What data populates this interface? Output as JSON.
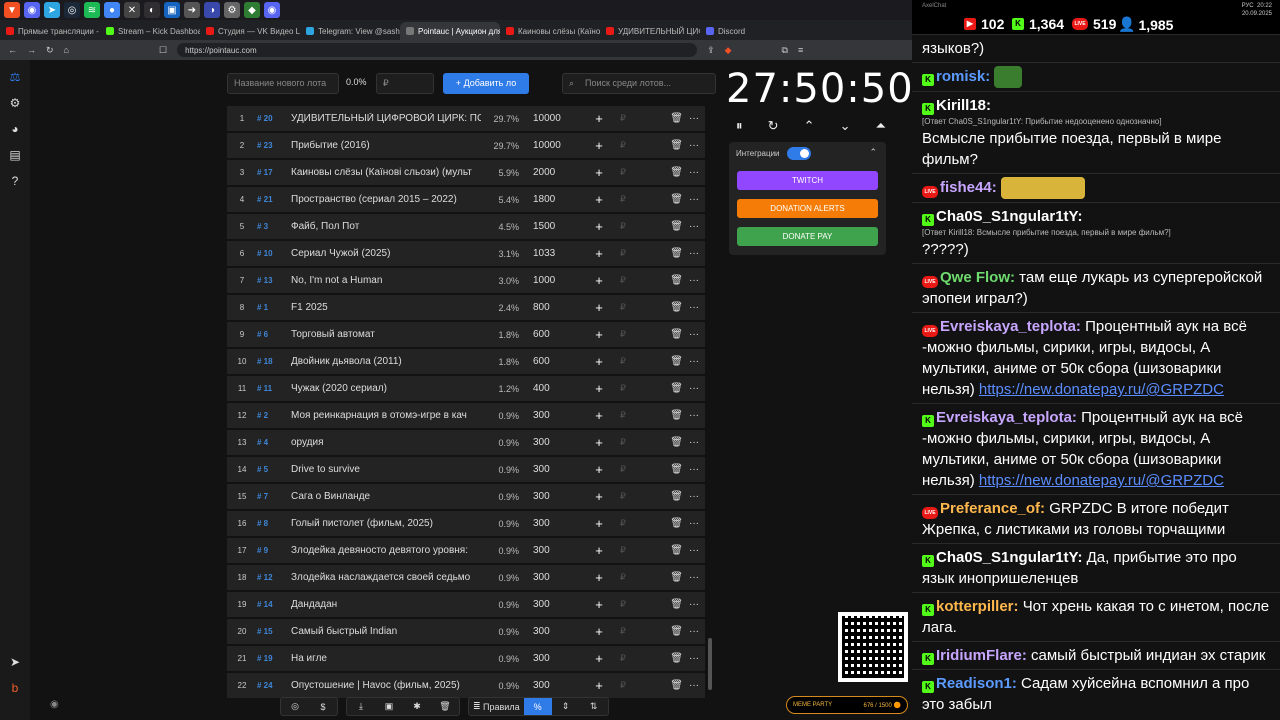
{
  "taskbar": {
    "icons": [
      "brave",
      "discord",
      "telegram",
      "steam",
      "spotify",
      "chrome",
      "close-app",
      "obs",
      "browser",
      "arrow",
      "ping",
      "settings",
      "app-green",
      "discord-2"
    ]
  },
  "tabs": [
    {
      "label": "Прямые трансляции - YouT",
      "color": "#e91916"
    },
    {
      "label": "Stream – Kick Dashboard",
      "color": "#53fc18"
    },
    {
      "label": "Студия — VK Видео Live",
      "color": "#e91916"
    },
    {
      "label": "Telegram: View @sashaicon",
      "color": "#2ca5e0"
    },
    {
      "label": "Pointauc | Аукцион для",
      "color": "#777777"
    },
    {
      "label": "Каиновы слёзы (Каїнові сл",
      "color": "#e91916"
    },
    {
      "label": "УДИВИТЕЛЬНЫЙ ЦИФРОВ",
      "color": "#e91916"
    },
    {
      "label": "Discord",
      "color": "#5865f2"
    }
  ],
  "address": {
    "url": "https://pointauc.com"
  },
  "toolbar": {
    "lot_placeholder": "Название нового лота",
    "percent": "0.0%",
    "amount_placeholder": "₽",
    "add_label": "Добавить ло",
    "search_placeholder": "Поиск среди лотов..."
  },
  "lots": [
    {
      "n": "1",
      "id": "# 20",
      "name": "УДИВИТЕЛЬНЫЙ ЦИФРОВОЙ ЦИРК: ПОСЛЕ",
      "pct": "29.7%",
      "amount": "10000"
    },
    {
      "n": "2",
      "id": "# 23",
      "name": "Прибытие (2016)",
      "pct": "29.7%",
      "amount": "10000"
    },
    {
      "n": "3",
      "id": "# 17",
      "name": "Каиновы слёзы (Каїнові сльози) (мульт",
      "pct": "5.9%",
      "amount": "2000"
    },
    {
      "n": "4",
      "id": "# 21",
      "name": "Пространство (сериал 2015 – 2022)",
      "pct": "5.4%",
      "amount": "1800"
    },
    {
      "n": "5",
      "id": "# 3",
      "name": "Файб, Пол Пот",
      "pct": "4.5%",
      "amount": "1500"
    },
    {
      "n": "6",
      "id": "# 10",
      "name": "Сериал Чужой (2025)",
      "pct": "3.1%",
      "amount": "1033"
    },
    {
      "n": "7",
      "id": "# 13",
      "name": "No, I'm not a Human",
      "pct": "3.0%",
      "amount": "1000"
    },
    {
      "n": "8",
      "id": "# 1",
      "name": "F1 2025",
      "pct": "2.4%",
      "amount": "800"
    },
    {
      "n": "9",
      "id": "# 6",
      "name": "Торговый автомат",
      "pct": "1.8%",
      "amount": "600"
    },
    {
      "n": "10",
      "id": "# 18",
      "name": "Двойник дьявола (2011)",
      "pct": "1.8%",
      "amount": "600"
    },
    {
      "n": "11",
      "id": "# 11",
      "name": "Чужак (2020 сериал)",
      "pct": "1.2%",
      "amount": "400"
    },
    {
      "n": "12",
      "id": "# 2",
      "name": "Моя реинкарнация в отомэ-игре в кач",
      "pct": "0.9%",
      "amount": "300"
    },
    {
      "n": "13",
      "id": "# 4",
      "name": "орудия",
      "pct": "0.9%",
      "amount": "300"
    },
    {
      "n": "14",
      "id": "# 5",
      "name": "Drive to survive",
      "pct": "0.9%",
      "amount": "300"
    },
    {
      "n": "15",
      "id": "# 7",
      "name": "Сага о Винланде",
      "pct": "0.9%",
      "amount": "300"
    },
    {
      "n": "16",
      "id": "# 8",
      "name": "Голый пистолет (фильм, 2025)",
      "pct": "0.9%",
      "amount": "300"
    },
    {
      "n": "17",
      "id": "# 9",
      "name": "Злодейка девяносто девятого уровня:",
      "pct": "0.9%",
      "amount": "300"
    },
    {
      "n": "18",
      "id": "# 12",
      "name": "Злодейка наслаждается своей седьмо",
      "pct": "0.9%",
      "amount": "300"
    },
    {
      "n": "19",
      "id": "# 14",
      "name": "Дандадан",
      "pct": "0.9%",
      "amount": "300"
    },
    {
      "n": "20",
      "id": "# 15",
      "name": "Самый быстрый Indian",
      "pct": "0.9%",
      "amount": "300"
    },
    {
      "n": "21",
      "id": "# 19",
      "name": "На игле",
      "pct": "0.9%",
      "amount": "300"
    },
    {
      "n": "22",
      "id": "# 24",
      "name": "Опустошение | Havoc (фильм, 2025)",
      "pct": "0.9%",
      "amount": "300"
    }
  ],
  "row_icons": {
    "plus": "+",
    "rub": "₽",
    "del": "🗑",
    "more": "···"
  },
  "timer": {
    "value": "27:50:50",
    "controls": [
      "⏸",
      "↻",
      "⌃",
      "⌄",
      "⏶"
    ]
  },
  "integrations": {
    "title": "Интеграции",
    "twitch": "TWITCH",
    "donation_alerts": "DONATION ALERTS",
    "donate_pay": "DONATE PAY",
    "colors": {
      "twitch": "#9146ff",
      "donation_alerts": "#f57d07",
      "donate_pay": "#3fa34d"
    }
  },
  "bottom": {
    "rules": "Правила",
    "percent_symbol": "%",
    "icons": [
      "github",
      "dollar",
      "download",
      "save",
      "bug",
      "trash",
      "list",
      "percent",
      "split",
      "sort"
    ]
  },
  "meme": {
    "label": "MEME PARTY",
    "progress": "676 / 1500 🟠"
  },
  "stats": {
    "app": "AxelChat",
    "youtube": "102",
    "kick": "1,364",
    "vk": "519",
    "users": "1,985",
    "lang": "РУС",
    "time": "20:22",
    "date": "20.09.2025"
  },
  "chat": [
    {
      "badge": "",
      "user": "",
      "color": "#ffffff",
      "reply": "",
      "text": "языков?)"
    },
    {
      "badge": "kick",
      "user": "romisk:",
      "color": "#5b9bff",
      "reply": "",
      "text": "",
      "emote": "pepe"
    },
    {
      "badge": "kick",
      "user": "Kirill18:",
      "color": "#ffffff",
      "reply": "[Ответ Cha0S_S1ngular1tY: Прибытие недооценено однозначно]",
      "text": "Всмысле прибытие поезда, первый в мире фильм?"
    },
    {
      "badge": "live",
      "user": "fishe44:",
      "color": "#c7a6ff",
      "reply": "",
      "text": "",
      "emote": "cry"
    },
    {
      "badge": "kick",
      "user": "Cha0S_S1ngular1tY:",
      "color": "#ffffff",
      "reply": "[Ответ Kirill18: Всмысле прибытие поезда, первый в мире фильм?]",
      "text": "?????)"
    },
    {
      "badge": "live",
      "user": "Qwe Flow:",
      "color": "#6ddb6d",
      "reply": "",
      "text": "там еще лукарь из супергеройской эпопеи играл?)"
    },
    {
      "badge": "live",
      "user": "Evreiskaya_teplota:",
      "color": "#c7a6ff",
      "reply": "",
      "text": "Процентный аук на всё -можно фильмы, сирики, игры, видосы, А мультики, аниме от 50к сбора (шизоварики нельзя)",
      "link": "https://new.donatepay.ru/@GRPZDC"
    },
    {
      "badge": "kick",
      "user": "Evreiskaya_teplota:",
      "color": "#c7a6ff",
      "reply": "",
      "text": "Процентный аук на всё -можно фильмы, сирики, игры, видосы, А мультики, аниме от 50к сбора (шизоварики нельзя)",
      "link": "https://new.donatepay.ru/@GRPZDC"
    },
    {
      "badge": "live",
      "user": "Preferance_of:",
      "color": "#ffb84d",
      "reply": "",
      "text": "GRPZDC В итоге победит Жрепка, с листиками из головы торчащими"
    },
    {
      "badge": "kick",
      "user": "Cha0S_S1ngular1tY:",
      "color": "#ffffff",
      "reply": "",
      "text": "Да, прибытие это про язык инопришеленцев"
    },
    {
      "badge": "kick",
      "user": "kotterpiller:",
      "color": "#ffb84d",
      "reply": "",
      "text": "Чот хрень какая то с инетом, после лага."
    },
    {
      "badge": "kick",
      "user": "IridiumFlare:",
      "color": "#c7a6ff",
      "reply": "",
      "text": "самый быстрый индиан эх старик"
    },
    {
      "badge": "kick",
      "user": "Readison1:",
      "color": "#5b9bff",
      "reply": "",
      "text": "Садам хуйсейна вспомнил а про это забыл"
    }
  ]
}
